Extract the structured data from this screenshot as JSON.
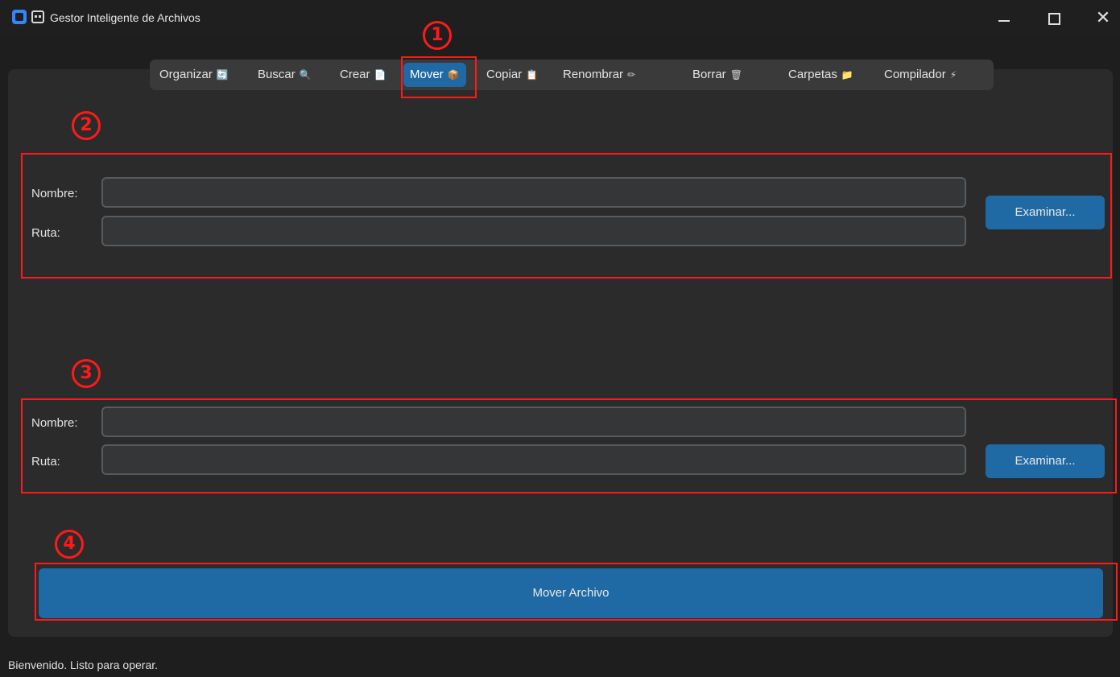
{
  "window": {
    "title": "Gestor Inteligente de Archivos",
    "minimize_glyph": "–",
    "close_glyph": "✕"
  },
  "tabs": [
    {
      "label": "Organizar",
      "icon": "🔄",
      "icon_name": "organize-icon"
    },
    {
      "label": "Buscar",
      "icon": "🔍",
      "icon_name": "search-icon"
    },
    {
      "label": "Crear",
      "icon": "📄",
      "icon_name": "document-icon"
    },
    {
      "label": "Mover",
      "icon": "📦",
      "icon_name": "package-icon",
      "active": true
    },
    {
      "label": "Copiar",
      "icon": "📋",
      "icon_name": "clipboard-icon"
    },
    {
      "label": "Renombrar",
      "icon": "✏",
      "icon_name": "pencil-icon"
    },
    {
      "label": "Borrar",
      "icon": "🗑",
      "icon_name": "trash-icon"
    },
    {
      "label": "Carpetas",
      "icon": "📁",
      "icon_name": "folder-icon"
    },
    {
      "label": "Compilador",
      "icon": "⚡",
      "icon_name": "lightning-icon"
    }
  ],
  "origin": {
    "name_label": "Nombre:",
    "name_value": "",
    "path_label": "Ruta:",
    "path_value": "",
    "browse_label": "Examinar..."
  },
  "destination": {
    "name_label": "Nombre:",
    "name_value": "",
    "path_label": "Ruta:",
    "path_value": "",
    "browse_label": "Examinar..."
  },
  "action": {
    "move_label": "Mover Archivo"
  },
  "annotations": [
    "1",
    "2",
    "3",
    "4"
  ],
  "status": "Bienvenido. Listo para operar.",
  "colors": {
    "accent": "#1f6aa5",
    "annotation": "#ff1a1a",
    "background": "#1e1e1e",
    "panel": "#2b2b2b"
  }
}
